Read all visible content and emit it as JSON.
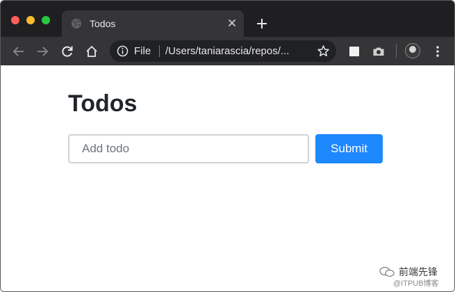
{
  "browser": {
    "tab": {
      "title": "Todos",
      "favicon": "globe-icon"
    },
    "omnibox": {
      "scheme_label": "File",
      "url": "/Users/taniarascia/repos/..."
    },
    "icons": {
      "back": "arrow-left-icon",
      "forward": "arrow-right-icon",
      "reload": "reload-icon",
      "home": "home-icon",
      "info": "info-icon",
      "bookmark": "star-icon",
      "extension1": "square-extension-icon",
      "extension2": "camera-icon",
      "profile": "avatar",
      "menu": "kebab-menu-icon"
    }
  },
  "page": {
    "title": "Todos",
    "input": {
      "placeholder": "Add todo",
      "value": ""
    },
    "submit_label": "Submit"
  },
  "watermark": {
    "line1": "前端先锋",
    "line2": "@ITPUB博客"
  },
  "colors": {
    "accent": "#1e88ff",
    "tabstrip_bg": "#1f1f21",
    "toolbar_bg": "#353538",
    "omnibox_bg": "#202124",
    "traffic_red": "#fe5f57",
    "traffic_yellow": "#febc2e",
    "traffic_green": "#28c840"
  }
}
